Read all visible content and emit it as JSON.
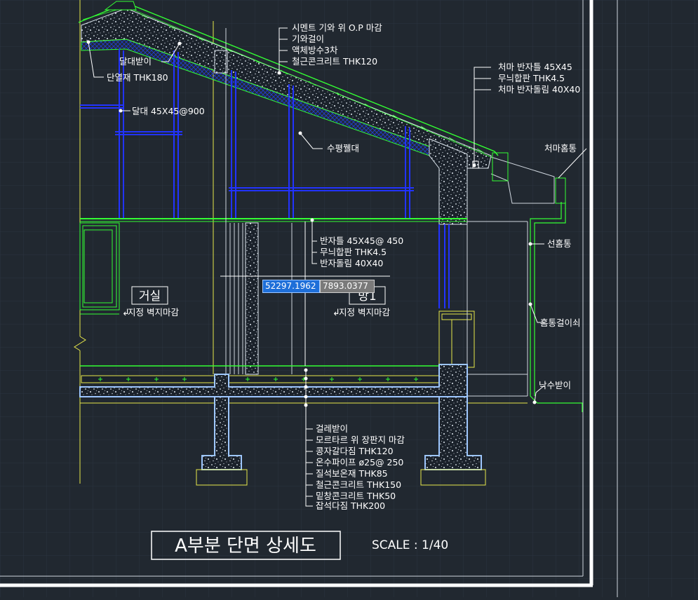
{
  "title": "A부분 단면 상세도",
  "scale": "SCALE : 1/40",
  "rooms": {
    "living": {
      "name": "거실",
      "finish": "지정 벽지마감"
    },
    "room1": {
      "name": "방1",
      "finish": "지정 벽지마감"
    }
  },
  "labels": {
    "roof": [
      "시멘트 기와 위 O.P 마감",
      "기와걸이",
      "액체방수3차",
      "철근콘크리트 THK120"
    ],
    "eave": [
      "처마 반자틀 45X45",
      "무늬합판 THK4.5",
      "처마 반자돌림 40X40"
    ],
    "dalbangi": "달대받이",
    "insulation": "단열재 THK180",
    "dalDae": "달대 45X45@900",
    "purlin": "수평꿸대",
    "gutterEave": "처마홈통",
    "ceiling": [
      "반자틀 45X45@ 450",
      "무늬합판 THK4.5",
      "반자돌림 40X40"
    ],
    "downspout": "선홈통",
    "pipeHanger": "홈통걸이쇠",
    "splash": "낙수받이",
    "floor": [
      "걸레받이",
      "모르타르 위 장판지 마감",
      "콩자갈다짐 THK120",
      "온수파이프 ø25@ 250",
      "질석보온재 THK85",
      "철근콘크리트 THK150",
      "밑창콘크리트 THK50",
      "잡석다짐 THK200"
    ]
  },
  "cursor": {
    "x": "52297.1962",
    "y": "7893.0377"
  },
  "colors": {
    "background": "#212830",
    "text": "#ffffff",
    "green": "#33ff33",
    "blue": "#2233ff",
    "yellow": "#e8e84a",
    "concrete": "#c8d8e8",
    "frame": "#ffffff"
  }
}
